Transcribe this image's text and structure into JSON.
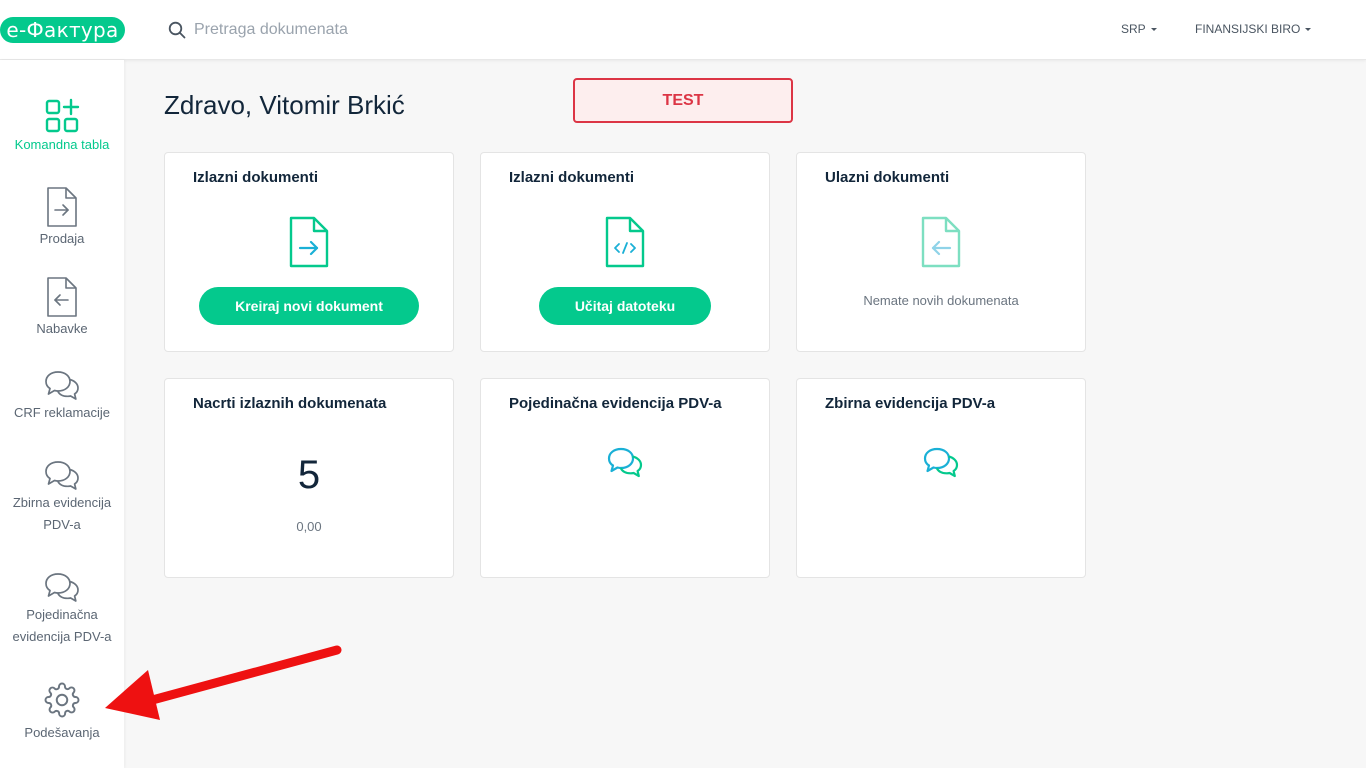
{
  "header": {
    "logo": "e-Фактура",
    "search_placeholder": "Pretraga dokumenata",
    "language": "SRP",
    "company": "FINANSIJSKI BIRO"
  },
  "sidebar": {
    "items": [
      {
        "label": "Komandna tabla",
        "icon": "dashboard-icon",
        "active": true
      },
      {
        "label": "Prodaja",
        "icon": "document-arrow-right-icon"
      },
      {
        "label": "Nabavke",
        "icon": "document-arrow-left-icon"
      },
      {
        "label": "CRF reklamacije",
        "icon": "chat-bubbles-icon"
      },
      {
        "label": "Zbirna evidencija PDV-a",
        "icon": "chat-bubbles-icon"
      },
      {
        "label": "Pojedinačna evidencija PDV-a",
        "icon": "chat-bubbles-icon"
      },
      {
        "label": "Podešavanja",
        "icon": "gear-icon"
      }
    ]
  },
  "main": {
    "greeting": "Zdravo, Vitomir Brkić",
    "badge": "TEST",
    "cards": [
      {
        "title": "Izlazni dokumenti",
        "icon": "document-arrow-right-icon",
        "button": "Kreiraj novi dokument"
      },
      {
        "title": "Izlazni dokumenti",
        "icon": "document-code-icon",
        "button": "Učitaj datoteku"
      },
      {
        "title": "Ulazni dokumenti",
        "icon": "document-arrow-left-icon",
        "message": "Nemate novih dokumenata"
      },
      {
        "title": "Nacrti izlaznih dokumenata",
        "count": "5",
        "amount": "0,00"
      },
      {
        "title": "Pojedinačna evidencija PDV-a",
        "icon": "chat-bubbles-icon"
      },
      {
        "title": "Zbirna evidencija PDV-a",
        "icon": "chat-bubbles-icon"
      }
    ]
  },
  "colors": {
    "accent": "#04c98d",
    "accent_blue": "#1ab0d6",
    "badge_red": "#dc3545",
    "arrow_red": "#ee1111"
  }
}
